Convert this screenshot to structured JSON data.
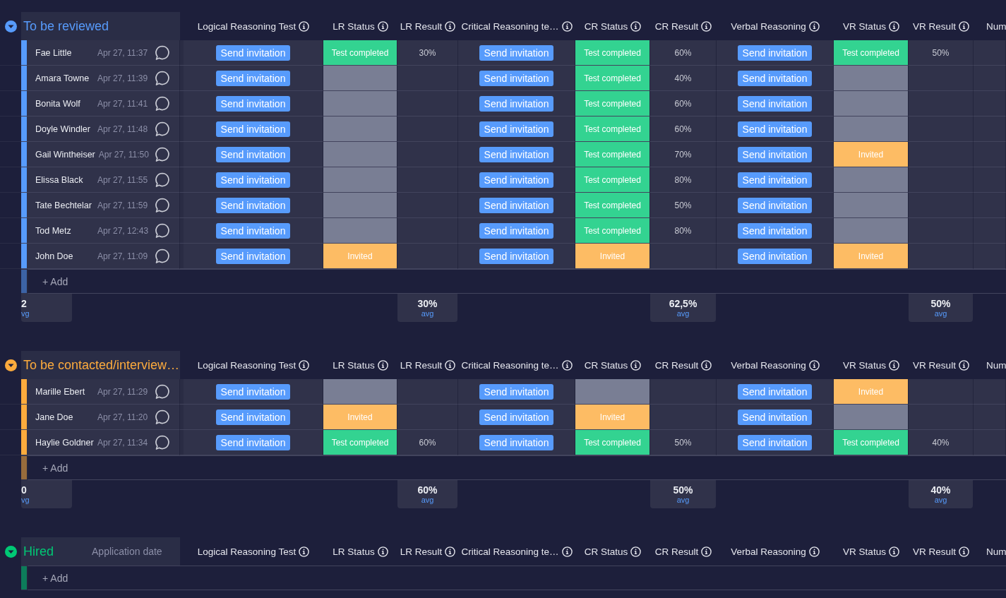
{
  "groups": [
    {
      "title": "To be reviewed",
      "color": "#579bfc",
      "expanded": true,
      "columns": [
        {
          "label": "Logical Reasoning Test",
          "info": true
        },
        {
          "label": "LR Status",
          "info": true
        },
        {
          "label": "LR Result",
          "info": true
        },
        {
          "label": "Critical Reasoning te…",
          "info": true
        },
        {
          "label": "CR Status",
          "info": true
        },
        {
          "label": "CR Result",
          "info": true
        },
        {
          "label": "Verbal Reasoning",
          "info": true
        },
        {
          "label": "VR Status",
          "info": true
        },
        {
          "label": "VR Result",
          "info": true
        },
        {
          "label": "Num",
          "info": false
        }
      ],
      "rows": [
        {
          "name": "Fae Little",
          "date": "Apr 27, 11:37",
          "tests": [
            {
              "button": "Send invitation",
              "status": {
                "kind": "completed",
                "label": "Test completed"
              },
              "result": "30%"
            },
            {
              "button": "Send invitation",
              "status": {
                "kind": "completed",
                "label": "Test completed"
              },
              "result": "60%"
            },
            {
              "button": "Send invitation",
              "status": {
                "kind": "completed",
                "label": "Test completed"
              },
              "result": "50%"
            }
          ]
        },
        {
          "name": "Amara Towne",
          "date": "Apr 27, 11:39",
          "tests": [
            {
              "button": "Send invitation",
              "status": {
                "kind": "empty"
              }
            },
            {
              "button": "Send invitation",
              "status": {
                "kind": "completed",
                "label": "Test completed"
              },
              "result": "40%"
            },
            {
              "button": "Send invitation",
              "status": {
                "kind": "empty"
              }
            }
          ]
        },
        {
          "name": "Bonita Wolf",
          "date": "Apr 27, 11:41",
          "tests": [
            {
              "button": "Send invitation",
              "status": {
                "kind": "empty"
              }
            },
            {
              "button": "Send invitation",
              "status": {
                "kind": "completed",
                "label": "Test completed"
              },
              "result": "60%"
            },
            {
              "button": "Send invitation",
              "status": {
                "kind": "empty"
              }
            }
          ]
        },
        {
          "name": "Doyle Windler",
          "date": "Apr 27, 11:48",
          "tests": [
            {
              "button": "Send invitation",
              "status": {
                "kind": "empty"
              }
            },
            {
              "button": "Send invitation",
              "status": {
                "kind": "completed",
                "label": "Test completed"
              },
              "result": "60%"
            },
            {
              "button": "Send invitation",
              "status": {
                "kind": "empty"
              }
            }
          ]
        },
        {
          "name": "Gail Wintheiser",
          "date": "Apr 27, 11:50",
          "tests": [
            {
              "button": "Send invitation",
              "status": {
                "kind": "empty"
              }
            },
            {
              "button": "Send invitation",
              "status": {
                "kind": "completed",
                "label": "Test completed"
              },
              "result": "70%"
            },
            {
              "button": "Send invitation",
              "status": {
                "kind": "invited",
                "label": "Invited"
              }
            }
          ]
        },
        {
          "name": "Elissa Black",
          "date": "Apr 27, 11:55",
          "tests": [
            {
              "button": "Send invitation",
              "status": {
                "kind": "empty"
              }
            },
            {
              "button": "Send invitation",
              "status": {
                "kind": "completed",
                "label": "Test completed"
              },
              "result": "80%"
            },
            {
              "button": "Send invitation",
              "status": {
                "kind": "empty"
              }
            }
          ]
        },
        {
          "name": "Tate Bechtelar",
          "date": "Apr 27, 11:59",
          "tests": [
            {
              "button": "Send invitation",
              "status": {
                "kind": "empty"
              }
            },
            {
              "button": "Send invitation",
              "status": {
                "kind": "completed",
                "label": "Test completed"
              },
              "result": "50%"
            },
            {
              "button": "Send invitation",
              "status": {
                "kind": "empty"
              }
            }
          ]
        },
        {
          "name": "Tod Metz",
          "date": "Apr 27, 12:43",
          "tests": [
            {
              "button": "Send invitation",
              "status": {
                "kind": "empty"
              }
            },
            {
              "button": "Send invitation",
              "status": {
                "kind": "completed",
                "label": "Test completed"
              },
              "result": "80%"
            },
            {
              "button": "Send invitation",
              "status": {
                "kind": "empty"
              }
            }
          ]
        },
        {
          "name": "John Doe",
          "date": "Apr 27, 11:09",
          "tests": [
            {
              "button": "Send invitation",
              "status": {
                "kind": "invited",
                "label": "Invited"
              }
            },
            {
              "button": "Send invitation",
              "status": {
                "kind": "invited",
                "label": "Invited"
              }
            },
            {
              "button": "Send invitation",
              "status": {
                "kind": "invited",
                "label": "Invited"
              }
            }
          ]
        }
      ],
      "add_label": "+ Add",
      "summary": {
        "first": {
          "value": "2",
          "label": "vg"
        },
        "results": [
          {
            "value": "30%",
            "label": "avg"
          },
          {
            "value": "62,5%",
            "label": "avg"
          },
          {
            "value": "50%",
            "label": "avg"
          }
        ]
      }
    },
    {
      "title": "To be contacted/interview…",
      "color": "#fdab3d",
      "expanded": true,
      "columns": [
        {
          "label": "Logical Reasoning Test",
          "info": true
        },
        {
          "label": "LR Status",
          "info": true
        },
        {
          "label": "LR Result",
          "info": true
        },
        {
          "label": "Critical Reasoning te…",
          "info": true
        },
        {
          "label": "CR Status",
          "info": true
        },
        {
          "label": "CR Result",
          "info": true
        },
        {
          "label": "Verbal Reasoning",
          "info": true
        },
        {
          "label": "VR Status",
          "info": true
        },
        {
          "label": "VR Result",
          "info": true
        },
        {
          "label": "Num",
          "info": false
        }
      ],
      "rows": [
        {
          "name": "Marille Ebert",
          "date": "Apr 27, 11:29",
          "tests": [
            {
              "button": "Send invitation",
              "status": {
                "kind": "empty"
              }
            },
            {
              "button": "Send invitation",
              "status": {
                "kind": "empty"
              }
            },
            {
              "button": "Send invitation",
              "status": {
                "kind": "invited",
                "label": "Invited"
              }
            }
          ]
        },
        {
          "name": "Jane Doe",
          "date": "Apr 27, 11:20",
          "tests": [
            {
              "button": "Send invitation",
              "status": {
                "kind": "invited",
                "label": "Invited"
              }
            },
            {
              "button": "Send invitation",
              "status": {
                "kind": "invited",
                "label": "Invited"
              }
            },
            {
              "button": "Send invitation",
              "status": {
                "kind": "empty"
              }
            }
          ]
        },
        {
          "name": "Haylie Goldner",
          "date": "Apr 27, 11:34",
          "tests": [
            {
              "button": "Send invitation",
              "status": {
                "kind": "completed",
                "label": "Test completed"
              },
              "result": "60%"
            },
            {
              "button": "Send invitation",
              "status": {
                "kind": "completed",
                "label": "Test completed"
              },
              "result": "50%"
            },
            {
              "button": "Send invitation",
              "status": {
                "kind": "completed",
                "label": "Test completed"
              },
              "result": "40%"
            }
          ]
        }
      ],
      "add_label": "+ Add",
      "summary": {
        "first": {
          "value": "0",
          "label": "vg"
        },
        "results": [
          {
            "value": "60%",
            "label": "avg"
          },
          {
            "value": "50%",
            "label": "avg"
          },
          {
            "value": "40%",
            "label": "avg"
          }
        ]
      }
    },
    {
      "title": "Hired",
      "color": "#00c875",
      "expanded": true,
      "date_header": "Application date",
      "columns": [
        {
          "label": "Logical Reasoning Test",
          "info": true
        },
        {
          "label": "LR Status",
          "info": true
        },
        {
          "label": "LR Result",
          "info": true
        },
        {
          "label": "Critical Reasoning te…",
          "info": true
        },
        {
          "label": "CR Status",
          "info": true
        },
        {
          "label": "CR Result",
          "info": true
        },
        {
          "label": "Verbal Reasoning",
          "info": true
        },
        {
          "label": "VR Status",
          "info": true
        },
        {
          "label": "VR Result",
          "info": true
        },
        {
          "label": "Num",
          "info": false
        }
      ],
      "add_label": "+ Add"
    }
  ]
}
